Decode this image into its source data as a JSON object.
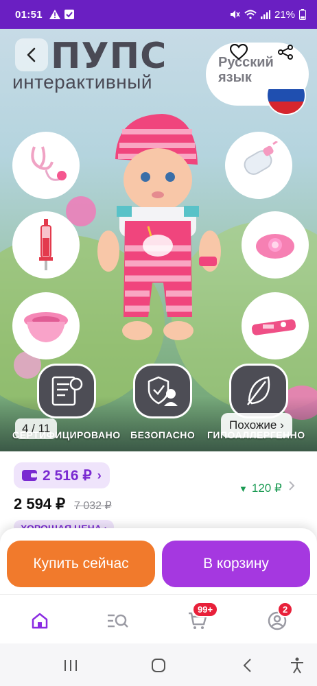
{
  "status_bar": {
    "time": "01:51",
    "battery": "21%"
  },
  "hero": {
    "title": "ПУПС",
    "subtitle": "интерактивный",
    "lang_badge": "Русский язык",
    "image_counter": "4 / 11",
    "similar_label": "Похожие ›",
    "features": [
      "СЕРТИФИЦИРОВАНО",
      "БЕЗОПАСНО",
      "ГИПОАЛЛЕРГЕННО"
    ]
  },
  "price": {
    "wallet_price": "2 516 ₽",
    "wallet_chevron": "›",
    "current": "2 594 ₽",
    "old": "7 032 ₽",
    "bonus": "120 ₽",
    "bonus_arrow": "▼",
    "good_price": "ХОРОШАЯ ЦЕНА ›"
  },
  "actions": {
    "buy_now": "Купить сейчас",
    "add_to_cart": "В корзину"
  },
  "nav": {
    "cart_badge": "99+",
    "profile_badge": "2"
  },
  "colors": {
    "accent": "#a538e0",
    "buy": "#f17a2c",
    "status": "#6a1fc2",
    "bonus": "#1a9a52"
  },
  "icons": [
    "back-icon",
    "heart-icon",
    "share-icon",
    "home-icon",
    "catalog-icon",
    "cart-icon",
    "profile-icon"
  ]
}
